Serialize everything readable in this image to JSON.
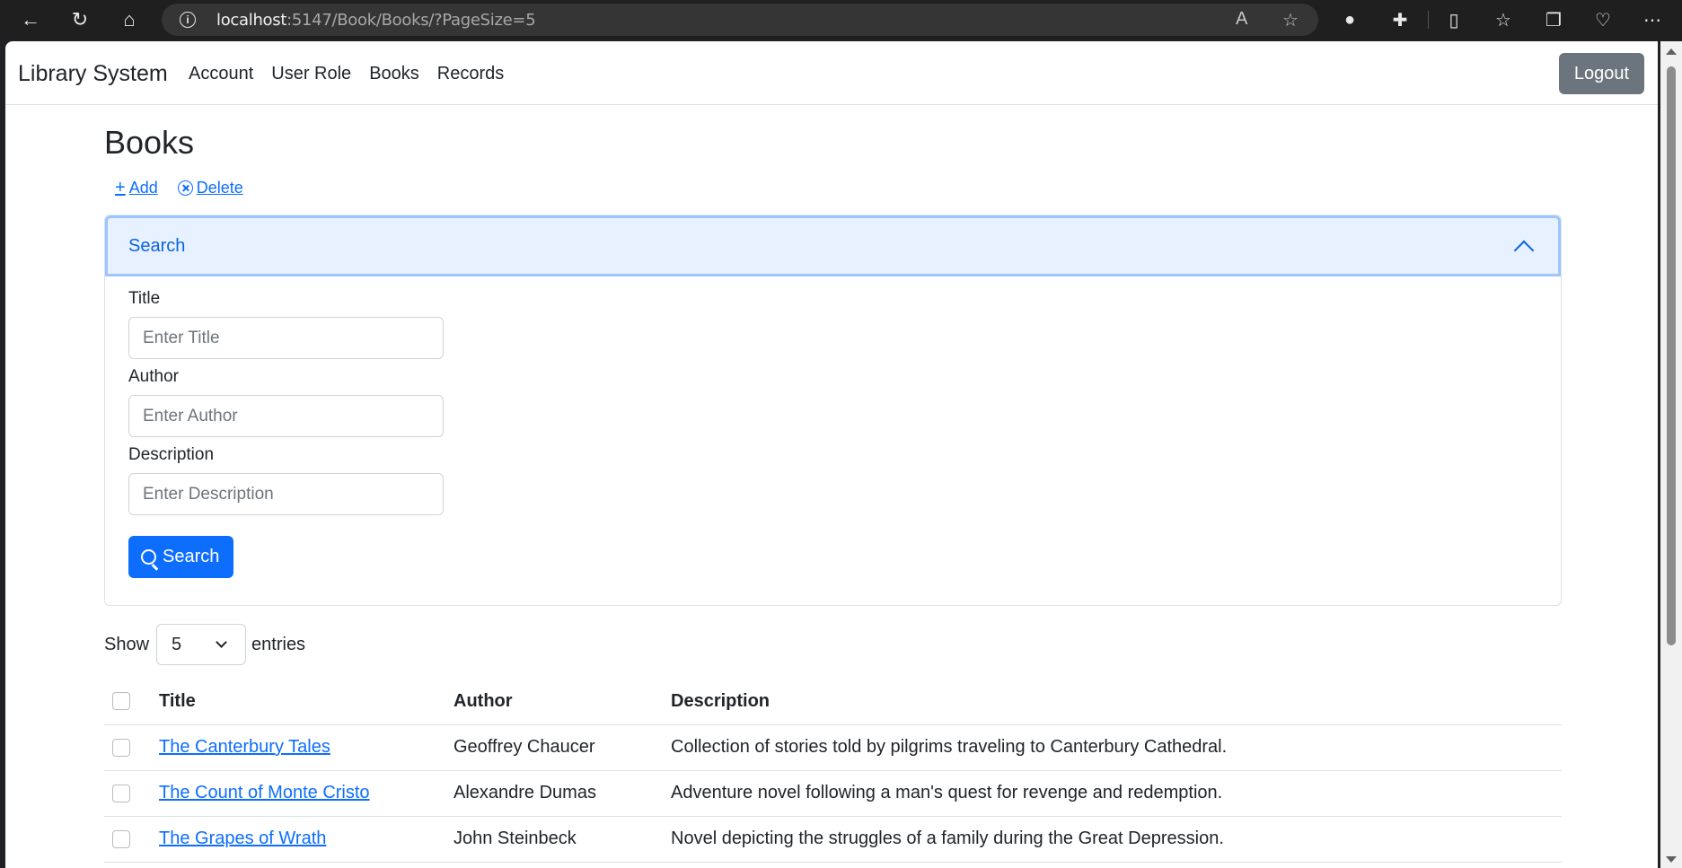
{
  "browser": {
    "url_host": "localhost",
    "url_rest": ":5147/Book/Books/?PageSize=5"
  },
  "navbar": {
    "brand": "Library System",
    "links": [
      "Account",
      "User Role",
      "Books",
      "Records"
    ],
    "logout_label": "Logout"
  },
  "page": {
    "title": "Books",
    "add_label": "Add",
    "delete_label": "Delete"
  },
  "search_panel": {
    "header": "Search",
    "title_label": "Title",
    "title_placeholder": "Enter Title",
    "author_label": "Author",
    "author_placeholder": "Enter Author",
    "description_label": "Description",
    "description_placeholder": "Enter Description",
    "search_button": "Search"
  },
  "entries": {
    "show_label": "Show",
    "page_size": "5",
    "entries_label": "entries"
  },
  "table": {
    "headers": [
      "Title",
      "Author",
      "Description"
    ],
    "rows": [
      {
        "title": "The Canterbury Tales",
        "author": "Geoffrey Chaucer",
        "description": "Collection of stories told by pilgrims traveling to Canterbury Cathedral."
      },
      {
        "title": "The Count of Monte Cristo",
        "author": "Alexandre Dumas",
        "description": "Adventure novel following a man's quest for revenge and redemption."
      },
      {
        "title": "The Grapes of Wrath",
        "author": "John Steinbeck",
        "description": "Novel depicting the struggles of a family during the Great Depression."
      }
    ]
  },
  "colors": {
    "primary": "#0d6efd",
    "secondary": "#6c757d",
    "accordion_bg": "#e7f1ff"
  }
}
